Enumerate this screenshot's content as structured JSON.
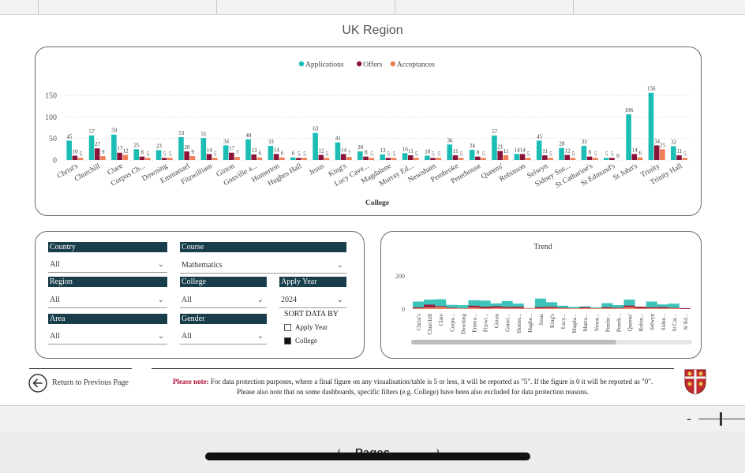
{
  "page_title": "UK Region",
  "legend": [
    {
      "label": "Applications",
      "color": "#1bbdb5"
    },
    {
      "label": "Offers",
      "color": "#8b1538"
    },
    {
      "label": "Acceptances",
      "color": "#f07e57"
    }
  ],
  "chart_data": {
    "type": "bar",
    "xlabel": "College",
    "ylabel": "",
    "ylim": [
      0,
      160
    ],
    "yticks": [
      0,
      50,
      100,
      150
    ],
    "categories": [
      "Christ's",
      "Churchill",
      "Clare",
      "Corpus Ch...",
      "Downing",
      "Emmanuel",
      "Fitzwilliam",
      "Girton",
      "Gonville a...",
      "Homerton",
      "Hughes Hall",
      "Jesus",
      "King's",
      "Lucy Cave...",
      "Magdalene",
      "Murray Ed...",
      "Newnham",
      "Pembroke",
      "Peterhouse",
      "Queens'",
      "Robinson",
      "Selwyn",
      "Sidney Sus...",
      "St Catharine's",
      "St Edmund's",
      "St John's",
      "Trinity",
      "Trinity Hall"
    ],
    "series": [
      {
        "name": "Applications",
        "values": [
          45,
          57,
          59,
          25,
          23,
          53,
          51,
          34,
          48,
          33,
          6,
          63,
          41,
          20,
          13,
          16,
          10,
          36,
          24,
          57,
          14,
          45,
          28,
          33,
          5,
          106,
          156,
          32
        ]
      },
      {
        "name": "Offers",
        "values": [
          10,
          27,
          17,
          8,
          5,
          20,
          14,
          17,
          13,
          14,
          5,
          12,
          14,
          8,
          5,
          11,
          5,
          11,
          8,
          21,
          14,
          11,
          12,
          8,
          5,
          14,
          34,
          11
        ]
      },
      {
        "name": "Acceptances",
        "values": [
          5,
          9,
          12,
          5,
          5,
          9,
          5,
          7,
          6,
          6,
          5,
          5,
          7,
          5,
          5,
          5,
          5,
          5,
          5,
          11,
          5,
          5,
          5,
          5,
          0,
          6,
          25,
          5
        ]
      }
    ]
  },
  "filters": {
    "country": {
      "label": "Country",
      "value": "All"
    },
    "course": {
      "label": "Course",
      "value": "Mathematics"
    },
    "region": {
      "label": "Region",
      "value": "All"
    },
    "college": {
      "label": "College",
      "value": "All"
    },
    "apply_year": {
      "label": "Apply Year",
      "value": "2024"
    },
    "area": {
      "label": "Area",
      "value": "All"
    },
    "gender": {
      "label": "Gender",
      "value": "All"
    },
    "sort_title": "SORT DATA BY",
    "sort_options": [
      {
        "label": "Apply Year",
        "checked": false
      },
      {
        "label": "College",
        "checked": true
      }
    ]
  },
  "trend": {
    "title": "Trend",
    "yticks": [
      "200",
      "0"
    ],
    "labels": [
      "Christ's",
      "Churchill",
      "Clare",
      "Corpu...",
      "Downing",
      "Emma...",
      "Fitzwi...",
      "Girton",
      "Gonvi...",
      "Homer...",
      "Hughe...",
      "Jesus",
      "King's",
      "Lucy...",
      "Magda...",
      "Murra...",
      "Newn...",
      "Pembr...",
      "Peterh...",
      "Queens'",
      "Robin...",
      "Selwyn",
      "Sidne...",
      "St Cat...",
      "St Ed..."
    ]
  },
  "back_label": "Return to Previous Page",
  "note": {
    "lead": "Please note:",
    "line1": " For data protection purposes, where a final figure on any visualisation/table is 5 or less, it will be reported as \"5\". If the figure is 0 it will be reported as \"0\".",
    "line2": "Please also note that on some dashboards, specific filters (e.g. College) have been also excluded for data protection reasons."
  },
  "zoom_minus": "-",
  "nav_label": "Pages"
}
